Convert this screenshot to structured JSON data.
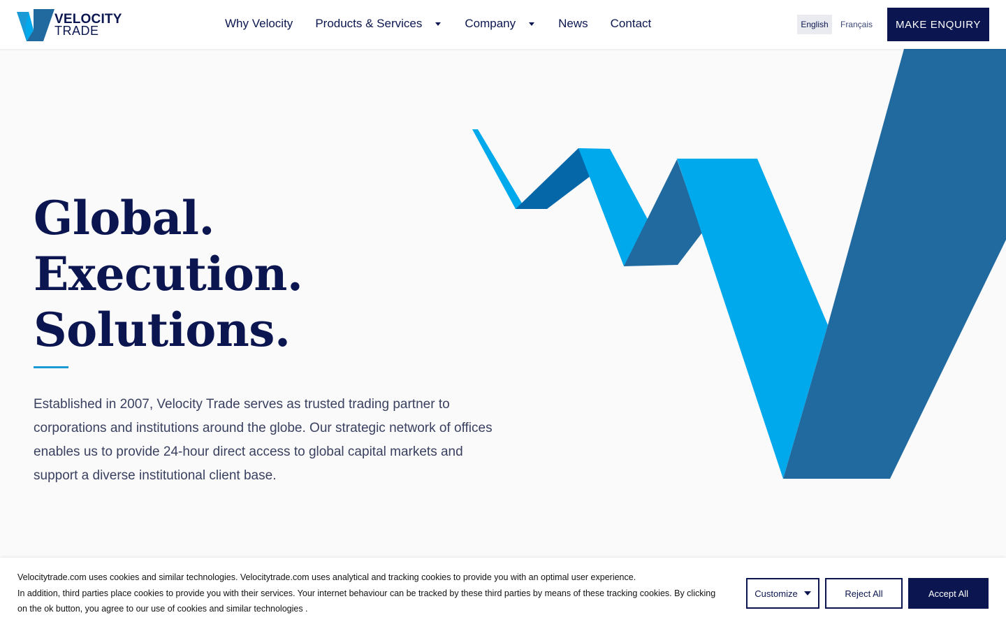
{
  "brand": {
    "name_line1": "VELOCITY",
    "name_line2": "TRADE",
    "colors": {
      "navy": "#0b1650",
      "blue": "#1b9ad6",
      "light_blue": "#00a8ec",
      "mid_blue": "#216aa0"
    }
  },
  "nav": {
    "items": [
      {
        "label": "Why Velocity",
        "has_dropdown": false
      },
      {
        "label": "Products & Services",
        "has_dropdown": true
      },
      {
        "label": "Company",
        "has_dropdown": true
      },
      {
        "label": "News",
        "has_dropdown": false
      },
      {
        "label": "Contact",
        "has_dropdown": false
      }
    ],
    "languages": {
      "english": "English",
      "french": "Français",
      "active": "English"
    },
    "cta_label": "MAKE ENQUIRY"
  },
  "hero": {
    "headline_lines": [
      "Global.",
      "Execution.",
      "Solutions."
    ],
    "intro": "Established in 2007, Velocity Trade serves as trusted trading partner to corporations and institutions around the globe. Our strategic network of offices enables us to provide 24-hour direct access to global capital markets and support a diverse institutional client base."
  },
  "cookie_banner": {
    "line1": "Velocitytrade.com uses cookies and similar technologies. Velocitytrade.com uses analytical and tracking cookies to provide you with an optimal user experience.",
    "line2": "In addition, third parties place cookies to provide you with their services. Your internet behaviour can be tracked by these third parties by means of these tracking cookies. By clicking on the ok button, you agree to our use of cookies and similar technologies .",
    "customize_label": "Customize",
    "reject_label": "Reject All",
    "accept_label": "Accept All"
  }
}
